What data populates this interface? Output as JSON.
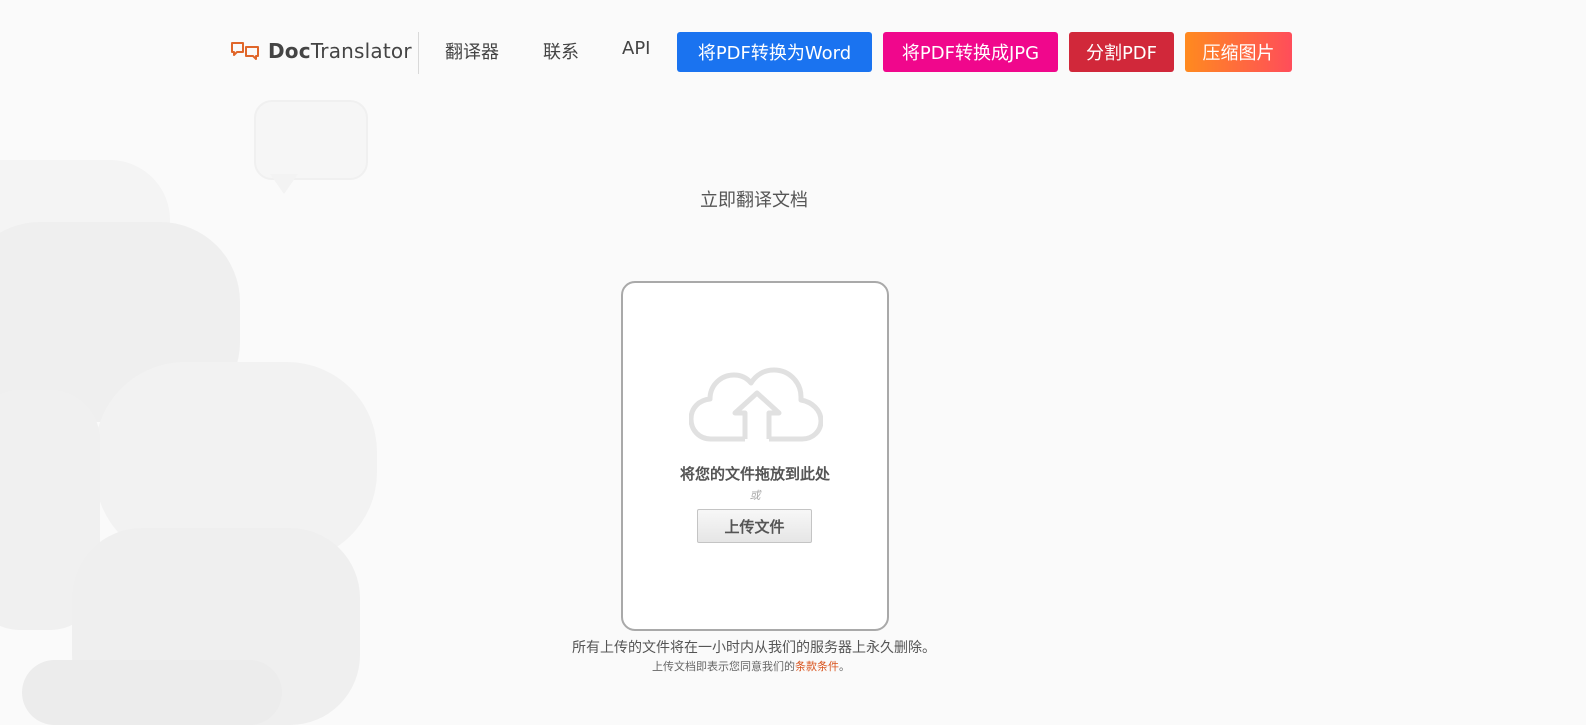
{
  "brand": {
    "name_bold": "Doc",
    "name_rest": "Translator",
    "accent_color": "#e0662a"
  },
  "nav": {
    "links": [
      "翻译器",
      "联系",
      "API"
    ],
    "buttons": [
      {
        "label": "将PDF转换为Word",
        "color": "#1a73f0"
      },
      {
        "label": "将PDF转换成JPG",
        "color": "#f0078c"
      },
      {
        "label": "分割PDF",
        "color": "#d1283a"
      },
      {
        "label": "压缩图片",
        "color_from": "#ff8a1f",
        "color_to": "#ff4d5a"
      }
    ]
  },
  "main": {
    "title": "立即翻译文档",
    "drop_text": "将您的文件拖放到此处",
    "or_text": "或",
    "upload_label": "上传文件",
    "icon": "cloud-upload-icon"
  },
  "footer": {
    "notice": "所有上传的文件将在一小时内从我们的服务器上永久删除。",
    "terms_prefix": "上传文档即表示您同意我们的",
    "terms_link": "条款条件",
    "terms_suffix": "。"
  }
}
